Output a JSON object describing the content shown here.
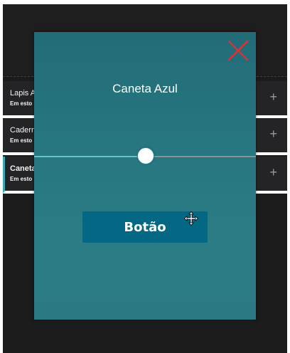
{
  "list": {
    "items": [
      {
        "title": "Lapis A",
        "subtitle": "Em esto",
        "add_icon": "+"
      },
      {
        "title": "Cadern",
        "subtitle": "Em esto",
        "add_icon": "+"
      },
      {
        "title": "Caneta",
        "subtitle": "Em esto",
        "add_icon": "+",
        "active": true
      }
    ]
  },
  "modal": {
    "title": "Caneta Azul",
    "close_icon": "close-x-icon",
    "slider_value_percent": 50,
    "button_label": "Botão"
  },
  "colors": {
    "modal_top": "#226c78",
    "modal_bottom": "#2b7a83",
    "button": "#046884",
    "close": "#d8323a",
    "slider_fill": "#63c3c7",
    "slider_rest": "#8a9298",
    "active_row_accent": "#3aa7b3"
  }
}
